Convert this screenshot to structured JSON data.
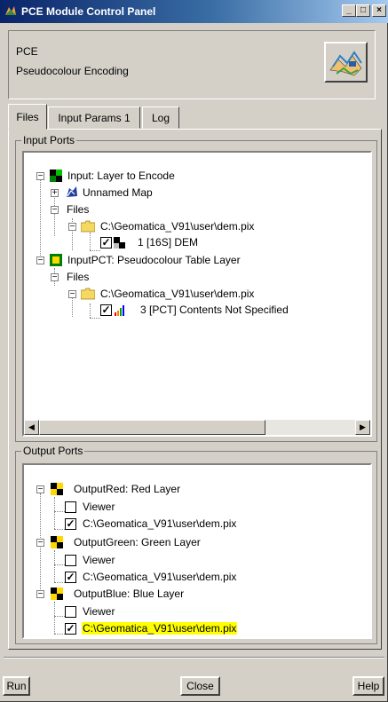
{
  "window": {
    "title": "PCE Module Control Panel",
    "min_label": "_",
    "max_label": "□",
    "close_label": "×"
  },
  "header": {
    "module_code": "PCE",
    "module_name": "Pseudocolour Encoding"
  },
  "tabs": [
    {
      "label": "Files",
      "active": true
    },
    {
      "label": "Input Params 1",
      "active": false
    },
    {
      "label": "Log",
      "active": false
    }
  ],
  "input_ports": {
    "legend": "Input Ports",
    "items": [
      "Input: Layer to Encode",
      "Unnamed Map",
      "Files",
      "C:\\Geomatica_V91\\user\\dem.pix",
      "1 [16S] DEM",
      "InputPCT: Pseudocolour Table Layer",
      "Files",
      "C:\\Geomatica_V91\\user\\dem.pix",
      "3 [PCT] Contents Not Specified"
    ]
  },
  "output_ports": {
    "legend": "Output Ports",
    "items": [
      "OutputRed: Red Layer",
      "Viewer",
      "C:\\Geomatica_V91\\user\\dem.pix",
      "OutputGreen: Green Layer",
      "Viewer",
      "C:\\Geomatica_V91\\user\\dem.pix",
      "OutputBlue: Blue Layer",
      "Viewer",
      "C:\\Geomatica_V91\\user\\dem.pix"
    ]
  },
  "buttons": {
    "run": "Run",
    "close": "Close",
    "help": "Help"
  },
  "highlight_color": "#ffff00",
  "title_color": "#0a246a"
}
